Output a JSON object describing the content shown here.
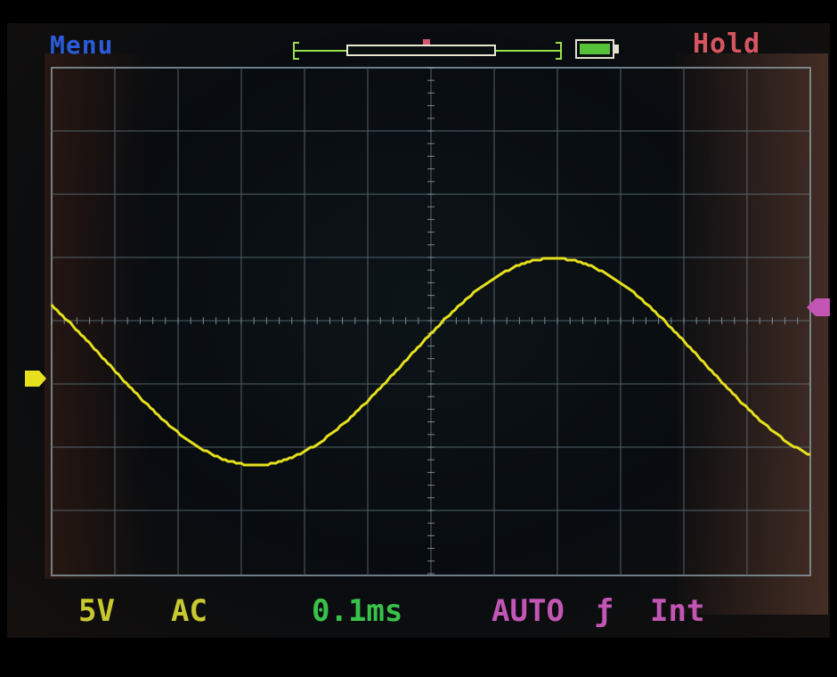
{
  "top_bar": {
    "menu_label": "Menu",
    "hold_label": "Hold",
    "battery_icon": "battery-icon",
    "buffer_icon": "buffer-position-indicator"
  },
  "status_bar": {
    "volts_per_div": "5V",
    "coupling": "AC",
    "time_per_div": "0.1ms",
    "trigger_mode": "AUTO",
    "trigger_edge": "ƒ",
    "trigger_source": "Int"
  },
  "colors": {
    "trace": "#e6e01e",
    "grid": "#6a7e86",
    "menu": "#2b5bd8",
    "hold": "#d85560",
    "volt": "#c8c830",
    "time": "#39c24a",
    "trigger": "#c356b5"
  },
  "waveform": {
    "shape": "sine"
  }
}
